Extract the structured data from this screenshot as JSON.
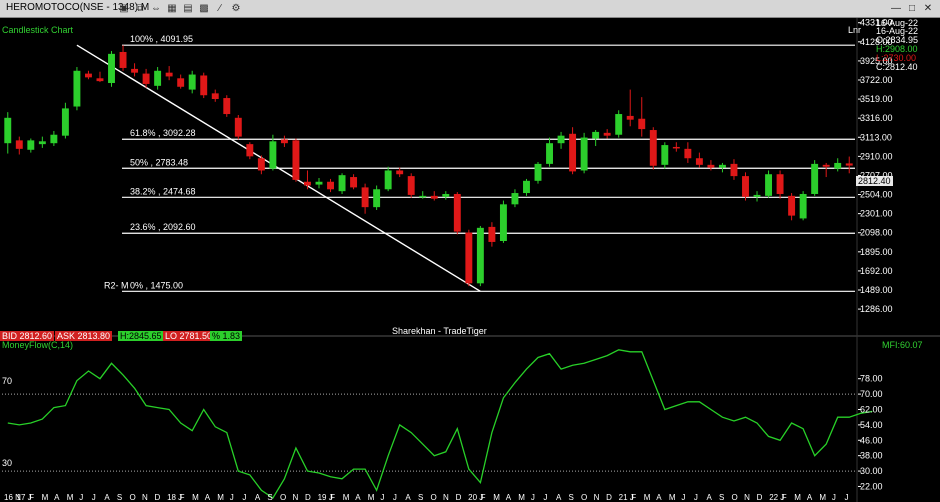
{
  "window": {
    "title": "HEROMOTOCO(NSE - 1348) M",
    "icons": [
      "lock-icon",
      "copy-icon",
      "arrows-icon",
      "grid-icon",
      "chart-icon",
      "bars-icon",
      "line-icon",
      "settings-icon"
    ]
  },
  "chart_header": {
    "name": "Candlestick Chart",
    "scale_mode": "Lnr",
    "date1": "16-Aug-22",
    "date2": "16-Aug-22",
    "ohlc_o": "O:2834.95",
    "ohlc_h": "H:2908.00",
    "ohlc_l": "L:2730.00",
    "ohlc_c": "C:2812.40",
    "last_price": "2812.40"
  },
  "status_bar": {
    "bid": "BID 2812.60",
    "ask": "ASK 2813.80",
    "high": "H:2845.65",
    "low": "LO 2781.50",
    "pct": "% 1.83",
    "watermark": "Sharekhan - TradeTiger"
  },
  "indicator_panel": {
    "name": "MoneyFlow(C,14)",
    "value": "MFI:60.07",
    "level_high": "70",
    "level_low": "30"
  },
  "chart_data": [
    {
      "type": "candlestick",
      "title": "Candlestick Chart",
      "ylim": [
        1170,
        4360
      ],
      "y_ticks": [
        "4331.00",
        "4128.00",
        "3925.00",
        "3722.00",
        "3519.00",
        "3316.00",
        "3113.00",
        "2910.00",
        "2707.00",
        "2504.00",
        "2301.00",
        "2098.00",
        "1895.00",
        "1692.00",
        "1489.00",
        "1286.00"
      ],
      "fibonacci": [
        {
          "label": "100%  , 4091.95",
          "value": 4091.95
        },
        {
          "label": "61.8%  , 3092.28",
          "value": 3092.28
        },
        {
          "label": "50%  , 2783.48",
          "value": 2783.48
        },
        {
          "label": "38.2%  , 2474.68",
          "value": 2474.68
        },
        {
          "label": "23.6%  , 2092.60",
          "value": 2092.6
        },
        {
          "label": "0%  , 1475.00",
          "value": 1475.0
        }
      ],
      "fib_prefix": "R2- M",
      "trendline": {
        "from": [
          6,
          4091.95
        ],
        "to": [
          41,
          1475.0
        ]
      },
      "candles": [
        {
          "o": 3050,
          "h": 3380,
          "l": 2940,
          "c": 3320
        },
        {
          "o": 3080,
          "h": 3120,
          "l": 2930,
          "c": 2990
        },
        {
          "o": 2980,
          "h": 3100,
          "l": 2950,
          "c": 3080
        },
        {
          "o": 3040,
          "h": 3120,
          "l": 3000,
          "c": 3070
        },
        {
          "o": 3050,
          "h": 3180,
          "l": 3020,
          "c": 3140
        },
        {
          "o": 3130,
          "h": 3480,
          "l": 3100,
          "c": 3420
        },
        {
          "o": 3440,
          "h": 3860,
          "l": 3400,
          "c": 3820
        },
        {
          "o": 3790,
          "h": 3820,
          "l": 3730,
          "c": 3750
        },
        {
          "o": 3740,
          "h": 3810,
          "l": 3700,
          "c": 3710
        },
        {
          "o": 3690,
          "h": 4030,
          "l": 3650,
          "c": 4000
        },
        {
          "o": 4020,
          "h": 4091,
          "l": 3820,
          "c": 3850
        },
        {
          "o": 3840,
          "h": 3900,
          "l": 3760,
          "c": 3800
        },
        {
          "o": 3790,
          "h": 3840,
          "l": 3640,
          "c": 3680
        },
        {
          "o": 3660,
          "h": 3860,
          "l": 3620,
          "c": 3820
        },
        {
          "o": 3800,
          "h": 3870,
          "l": 3720,
          "c": 3760
        },
        {
          "o": 3740,
          "h": 3780,
          "l": 3630,
          "c": 3650
        },
        {
          "o": 3620,
          "h": 3820,
          "l": 3580,
          "c": 3780
        },
        {
          "o": 3770,
          "h": 3800,
          "l": 3530,
          "c": 3560
        },
        {
          "o": 3580,
          "h": 3620,
          "l": 3490,
          "c": 3520
        },
        {
          "o": 3530,
          "h": 3560,
          "l": 3330,
          "c": 3360
        },
        {
          "o": 3320,
          "h": 3350,
          "l": 3090,
          "c": 3120
        },
        {
          "o": 3040,
          "h": 3060,
          "l": 2880,
          "c": 2910
        },
        {
          "o": 2890,
          "h": 2920,
          "l": 2720,
          "c": 2760
        },
        {
          "o": 2780,
          "h": 3140,
          "l": 2760,
          "c": 3070
        },
        {
          "o": 3090,
          "h": 3130,
          "l": 3010,
          "c": 3050
        },
        {
          "o": 3080,
          "h": 3100,
          "l": 2640,
          "c": 2660
        },
        {
          "o": 2640,
          "h": 2760,
          "l": 2560,
          "c": 2600
        },
        {
          "o": 2610,
          "h": 2680,
          "l": 2570,
          "c": 2640
        },
        {
          "o": 2640,
          "h": 2670,
          "l": 2530,
          "c": 2560
        },
        {
          "o": 2540,
          "h": 2730,
          "l": 2510,
          "c": 2710
        },
        {
          "o": 2690,
          "h": 2720,
          "l": 2560,
          "c": 2580
        },
        {
          "o": 2580,
          "h": 2620,
          "l": 2300,
          "c": 2370
        },
        {
          "o": 2370,
          "h": 2600,
          "l": 2340,
          "c": 2560
        },
        {
          "o": 2560,
          "h": 2800,
          "l": 2540,
          "c": 2760
        },
        {
          "o": 2760,
          "h": 2790,
          "l": 2690,
          "c": 2720
        },
        {
          "o": 2700,
          "h": 2730,
          "l": 2470,
          "c": 2500
        },
        {
          "o": 2490,
          "h": 2540,
          "l": 2460,
          "c": 2490
        },
        {
          "o": 2490,
          "h": 2540,
          "l": 2440,
          "c": 2460
        },
        {
          "o": 2480,
          "h": 2540,
          "l": 2450,
          "c": 2510
        },
        {
          "o": 2510,
          "h": 2530,
          "l": 2080,
          "c": 2110
        },
        {
          "o": 2100,
          "h": 2130,
          "l": 1530,
          "c": 1560
        },
        {
          "o": 1560,
          "h": 2170,
          "l": 1530,
          "c": 2150
        },
        {
          "o": 2160,
          "h": 2210,
          "l": 1950,
          "c": 2000
        },
        {
          "o": 2010,
          "h": 2440,
          "l": 1990,
          "c": 2400
        },
        {
          "o": 2400,
          "h": 2560,
          "l": 2370,
          "c": 2520
        },
        {
          "o": 2520,
          "h": 2670,
          "l": 2490,
          "c": 2650
        },
        {
          "o": 2650,
          "h": 2850,
          "l": 2620,
          "c": 2830
        },
        {
          "o": 2830,
          "h": 3110,
          "l": 2800,
          "c": 3050
        },
        {
          "o": 3050,
          "h": 3170,
          "l": 2990,
          "c": 3130
        },
        {
          "o": 3150,
          "h": 3220,
          "l": 2720,
          "c": 2750
        },
        {
          "o": 2760,
          "h": 3160,
          "l": 2730,
          "c": 3110
        },
        {
          "o": 3100,
          "h": 3190,
          "l": 3020,
          "c": 3170
        },
        {
          "o": 3160,
          "h": 3200,
          "l": 3100,
          "c": 3130
        },
        {
          "o": 3140,
          "h": 3400,
          "l": 3110,
          "c": 3360
        },
        {
          "o": 3340,
          "h": 3620,
          "l": 3230,
          "c": 3300
        },
        {
          "o": 3310,
          "h": 3540,
          "l": 3120,
          "c": 3200
        },
        {
          "o": 3190,
          "h": 3220,
          "l": 2770,
          "c": 2810
        },
        {
          "o": 2820,
          "h": 3060,
          "l": 2780,
          "c": 3030
        },
        {
          "o": 3010,
          "h": 3060,
          "l": 2960,
          "c": 3000
        },
        {
          "o": 2990,
          "h": 3060,
          "l": 2840,
          "c": 2890
        },
        {
          "o": 2890,
          "h": 2950,
          "l": 2790,
          "c": 2820
        },
        {
          "o": 2820,
          "h": 2870,
          "l": 2760,
          "c": 2790
        },
        {
          "o": 2790,
          "h": 2840,
          "l": 2740,
          "c": 2820
        },
        {
          "o": 2830,
          "h": 2880,
          "l": 2660,
          "c": 2700
        },
        {
          "o": 2700,
          "h": 2740,
          "l": 2440,
          "c": 2480
        },
        {
          "o": 2480,
          "h": 2540,
          "l": 2430,
          "c": 2500
        },
        {
          "o": 2490,
          "h": 2760,
          "l": 2470,
          "c": 2720
        },
        {
          "o": 2720,
          "h": 2760,
          "l": 2460,
          "c": 2510
        },
        {
          "o": 2490,
          "h": 2520,
          "l": 2230,
          "c": 2280
        },
        {
          "o": 2250,
          "h": 2540,
          "l": 2230,
          "c": 2510
        },
        {
          "o": 2510,
          "h": 2870,
          "l": 2490,
          "c": 2830
        },
        {
          "o": 2820,
          "h": 2840,
          "l": 2690,
          "c": 2800
        },
        {
          "o": 2780,
          "h": 2890,
          "l": 2750,
          "c": 2840
        },
        {
          "o": 2835,
          "h": 2908,
          "l": 2730,
          "c": 2812
        }
      ]
    },
    {
      "type": "line",
      "title": "MoneyFlow(C,14)",
      "ylim": [
        16,
        95
      ],
      "y_ticks": [
        "78.00",
        "70.00",
        "62.00",
        "54.00",
        "46.00",
        "38.00",
        "30.00",
        "22.00"
      ],
      "levels": [
        70,
        30
      ],
      "series": [
        {
          "name": "MoneyFlow(C,14)",
          "values": [
            55,
            54,
            55,
            57,
            63,
            64,
            77,
            82,
            78,
            86,
            80,
            73,
            64,
            63,
            62,
            55,
            51,
            62,
            53,
            50,
            30,
            28,
            20,
            16,
            26,
            42,
            30,
            29,
            27,
            26,
            31,
            31,
            20,
            38,
            54,
            50,
            44,
            38,
            40,
            52,
            31,
            24,
            50,
            68,
            76,
            83,
            89,
            91,
            83,
            85,
            86,
            88,
            90,
            93,
            92,
            92,
            77,
            62,
            64,
            66,
            66,
            62,
            58,
            56,
            58,
            55,
            48,
            46,
            55,
            52,
            38,
            44,
            58,
            58,
            60,
            61
          ]
        }
      ]
    }
  ],
  "x_axis": {
    "labels": [
      "16 N",
      "17 J",
      "F",
      "M",
      "A",
      "M",
      "J",
      "J",
      "A",
      "S",
      "O",
      "N",
      "D",
      "18 J",
      "F",
      "M",
      "A",
      "M",
      "J",
      "J",
      "A",
      "S",
      "O",
      "N",
      "D",
      "19 J",
      "F",
      "M",
      "A",
      "M",
      "J",
      "J",
      "A",
      "S",
      "O",
      "N",
      "D",
      "20 J",
      "F",
      "M",
      "A",
      "M",
      "J",
      "J",
      "A",
      "S",
      "O",
      "N",
      "D",
      "21 J",
      "F",
      "M",
      "A",
      "M",
      "J",
      "J",
      "A",
      "S",
      "O",
      "N",
      "D",
      "22 J",
      "F",
      "M",
      "A",
      "M",
      "J",
      "J"
    ]
  },
  "colors": {
    "up": "#2ccf2c",
    "down": "#e01818",
    "mfi_line": "#28d028",
    "grid_line": "#ffffff",
    "last_price_bg": "#e8e8e8"
  }
}
